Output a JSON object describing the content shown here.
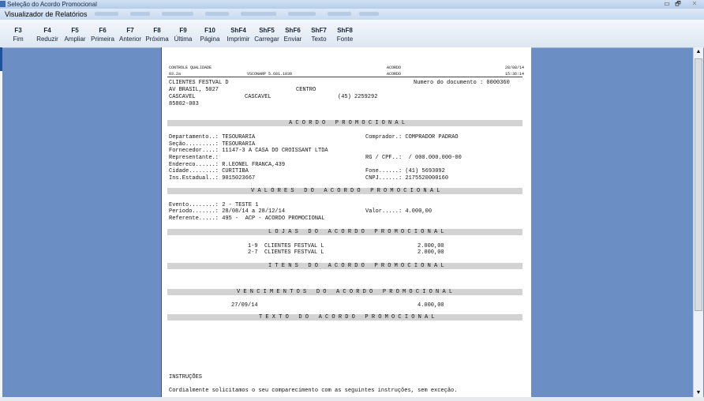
{
  "window": {
    "title": "Seleção do Acordo Promocional",
    "subtitle": "Visualizador de Relatórios",
    "controls": {
      "minimize": "▭",
      "maximize": "🗗",
      "close": "✕"
    }
  },
  "toolbar": [
    {
      "key": "F3",
      "label": "Fim"
    },
    {
      "key": "F4",
      "label": "Reduzir"
    },
    {
      "key": "F5",
      "label": "Ampliar"
    },
    {
      "key": "F6",
      "label": "Primeira"
    },
    {
      "key": "F7",
      "label": "Anterior"
    },
    {
      "key": "F8",
      "label": "Próxima"
    },
    {
      "key": "F9",
      "label": "Última"
    },
    {
      "key": "F10",
      "label": "Página"
    },
    {
      "key": "ShF4",
      "label": "Imprimir"
    },
    {
      "key": "ShF5",
      "label": "Carregar"
    },
    {
      "key": "ShF6",
      "label": "Enviar"
    },
    {
      "key": "ShF7",
      "label": "Texto"
    },
    {
      "key": "ShF8",
      "label": "Fonte"
    }
  ],
  "report": {
    "hdr1": "CONTROLE QUALIDADE",
    "hdr2": "03.2a",
    "system": "VSCONARP 5.681.1030",
    "acordo1": "ACORDO",
    "acordo2": "ACORDO",
    "date": "28/08/14",
    "time": "15:36:14",
    "client": "CLIENTES FESTVAL D",
    "doc_number": "Numero do documento : 0000360",
    "address": "AV BRASIL, 5027",
    "district": "CENTRO",
    "city1": "CASCAVEL",
    "city2": "CASCAVEL",
    "phone": "(45) 2259292",
    "cep": "85802-003",
    "section1": "A C O R D O   P R O M O C I O N A L",
    "dept": "Departamento..: TESOURARIA",
    "buyer": "Comprador.: COMPRADOR PADRAO",
    "secao": "Seção.........: TESOURARIA",
    "supplier": "Fornecedor....: 11147-3 A CASA DO CROISSANT LTDA",
    "rep": "Representante.:",
    "rg": "RG / CPF..:  / 000.000.000-00",
    "endereco": "Endereco......: R.LEONEL FRANCA,439",
    "cidade": "Cidade........: CURITIBA",
    "fone": "Fone......: (41) 5693092",
    "ins": "Ins.Estadual..: 9015023667",
    "cnpj": "CNPJ......: 2175520000160",
    "section2": "V A L O R E S   D O   A C O R D O   P R O M O C I O N A L",
    "evento": "Evento........: 2 - TESTE 1",
    "periodo": "Periodo.......: 28/08/14 a 28/12/14",
    "valor": "Valor.....: 4.000,00",
    "referente": "Referente.....: 495 -  ACP - ACORDO PROMOCIONAL",
    "section3": "L O J A S   D O   A C O R D O   P R O M O C I O N A L",
    "loja1": "1-9  CLIENTES FESTVAL L",
    "loja1_val": "2.000,00",
    "loja2": "2-7  CLIENTES FESTVAL L",
    "loja2_val": "2.000,00",
    "section4": "I T E N S   D O   A C O R D O   P R O M O C I O N A L",
    "section5": "V E N C I M E N T O S   D O   A C O R D O   P R O M O C I O N A L",
    "venc_date": "27/09/14",
    "venc_val": "4.000,00",
    "section6": "T E X T O   D O   A C O R D O   P R O M O C I O N A L",
    "instr_title": "INSTRUÇÕES",
    "instr_text": "Cordialmente solicitamos o seu comparecimento com as seguintes instruções, sem exceção."
  },
  "scrollbar": {
    "up": "▲",
    "down": "▼"
  }
}
